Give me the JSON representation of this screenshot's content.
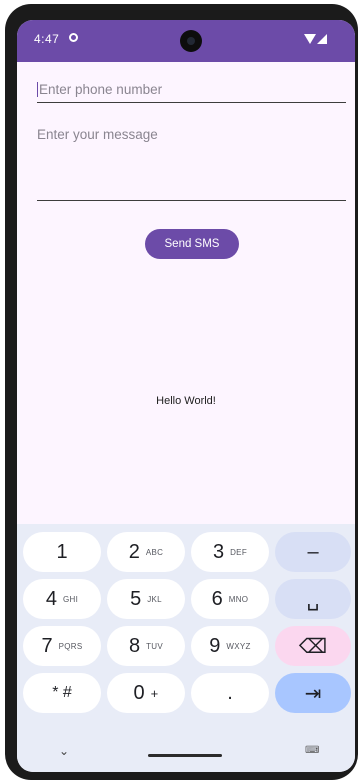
{
  "status_bar": {
    "time": "4:47",
    "accent": "#6c4ba8"
  },
  "form": {
    "phone_placeholder": "Enter phone number",
    "message_placeholder": "Enter your message",
    "send_label": "Send SMS"
  },
  "body_text": "Hello World!",
  "keyboard": {
    "keys": [
      {
        "main": "1",
        "sub": ""
      },
      {
        "main": "2",
        "sub": "ABC"
      },
      {
        "main": "3",
        "sub": "DEF"
      },
      {
        "main": "–",
        "sub": ""
      },
      {
        "main": "4",
        "sub": "GHI"
      },
      {
        "main": "5",
        "sub": "JKL"
      },
      {
        "main": "6",
        "sub": "MNO"
      },
      {
        "main": "␣",
        "sub": ""
      },
      {
        "main": "7",
        "sub": "PQRS"
      },
      {
        "main": "8",
        "sub": "TUV"
      },
      {
        "main": "9",
        "sub": "WXYZ"
      },
      {
        "main": "⌫",
        "sub": ""
      },
      {
        "main": "* #",
        "sub": ""
      },
      {
        "main": "0",
        "sub": "+"
      },
      {
        "main": ".",
        "sub": ""
      },
      {
        "main": "⇥",
        "sub": ""
      }
    ]
  },
  "nav": {
    "back": "⌄",
    "keyboard_switch": "⌨"
  }
}
